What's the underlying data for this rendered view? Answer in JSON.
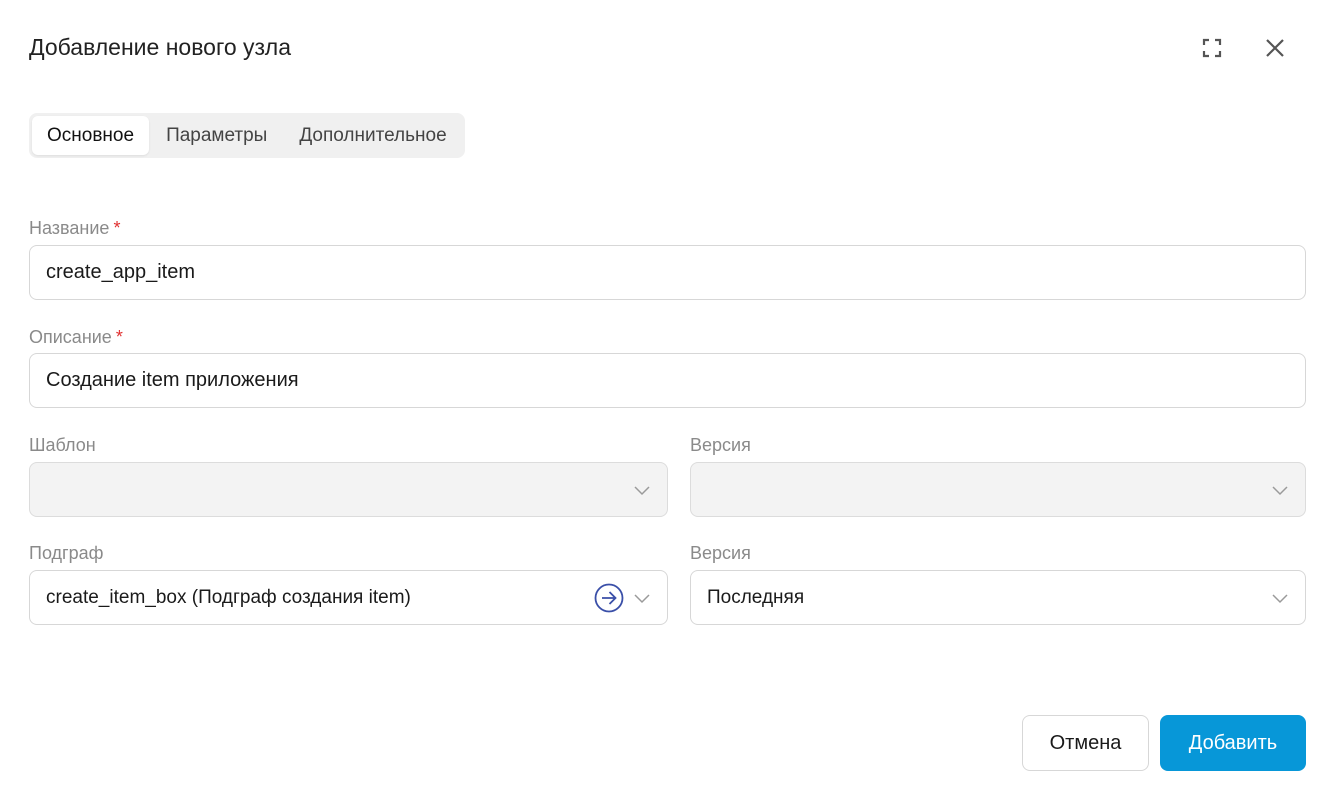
{
  "dialog": {
    "title": "Добавление нового узла",
    "icons": {
      "expand": "expand-icon",
      "close": "close-icon"
    }
  },
  "tabs": [
    {
      "label": "Основное",
      "active": true
    },
    {
      "label": "Параметры",
      "active": false
    },
    {
      "label": "Дополнительное",
      "active": false
    }
  ],
  "form": {
    "name": {
      "label": "Название",
      "required_mark": "*",
      "value": "create_app_item"
    },
    "description": {
      "label": "Описание",
      "required_mark": "*",
      "value": "Создание item приложения"
    },
    "template": {
      "label": "Шаблон",
      "value": "",
      "disabled": true
    },
    "template_version": {
      "label": "Версия",
      "value": "",
      "disabled": true
    },
    "subgraph": {
      "label": "Подграф",
      "value": "create_item_box (Подграф создания item)"
    },
    "subgraph_version": {
      "label": "Версия",
      "value": "Последняя"
    }
  },
  "footer": {
    "cancel_label": "Отмена",
    "add_label": "Добавить"
  },
  "colors": {
    "accent": "#0797d8",
    "link_icon": "#3a4fa8",
    "required": "#e03030"
  }
}
